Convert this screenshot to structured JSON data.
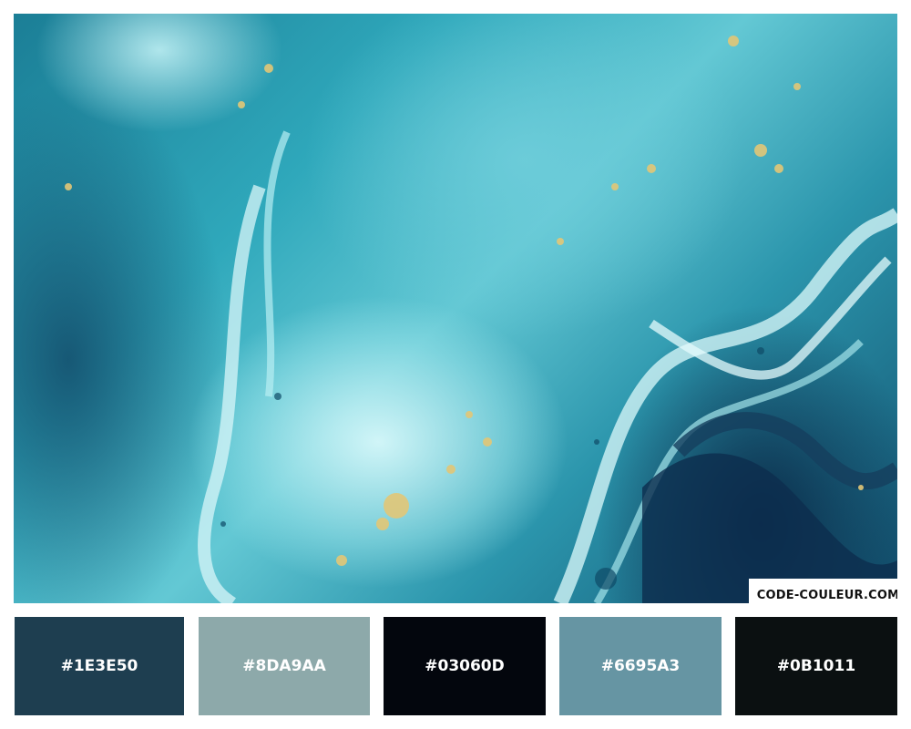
{
  "image": {
    "description_icon": "marble-texture-image",
    "watermark": "CODE-COULEUR.COM"
  },
  "palette": [
    {
      "hex": "#1E3E50",
      "color": "#1E3E50"
    },
    {
      "hex": "#8DA9AA",
      "color": "#8DA9AA"
    },
    {
      "hex": "#03060D",
      "color": "#03060D"
    },
    {
      "hex": "#6695A3",
      "color": "#6695A3"
    },
    {
      "hex": "#0B1011",
      "color": "#0B1011"
    }
  ]
}
